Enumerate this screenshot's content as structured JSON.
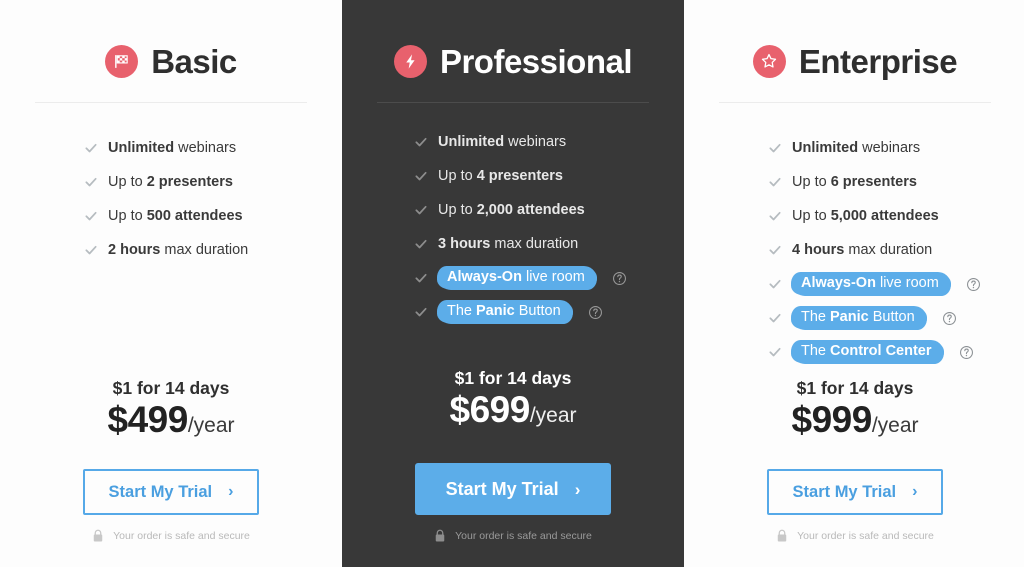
{
  "theme": {
    "page_background": "#ffffff",
    "card_background": "#fdfdfd",
    "featured_background": "#383838",
    "badge_color": "#e8616d",
    "accent_blue": "#5cade9",
    "highlight_blue": "#5cade9",
    "text_dark": "#2f2f2f",
    "text_light": "#ffffff",
    "check_gray": "#b6bcc0",
    "rule_gray": "#ececec"
  },
  "plans": [
    {
      "id": "basic",
      "name": "Basic",
      "icon": "checkered-flag-icon",
      "featured": false,
      "features": [
        {
          "prefix": "",
          "strong": "Unlimited",
          "suffix": " webinars",
          "highlight": false,
          "help": false
        },
        {
          "prefix": "Up to ",
          "strong": "2 presenters",
          "suffix": "",
          "highlight": false,
          "help": false
        },
        {
          "prefix": "Up to ",
          "strong": "500 attendees",
          "suffix": "",
          "highlight": false,
          "help": false
        },
        {
          "prefix": "",
          "strong": "2 hours",
          "suffix": " max duration",
          "highlight": false,
          "help": false
        }
      ],
      "trial": "$1 for 14 days",
      "price": "$499",
      "period": "/year",
      "cta_label": "Start My Trial",
      "cta_arrow": "›",
      "secure_note": "Your order is safe and secure"
    },
    {
      "id": "professional",
      "name": "Professional",
      "icon": "lightning-bolt-icon",
      "featured": true,
      "features": [
        {
          "prefix": "",
          "strong": "Unlimited",
          "suffix": " webinars",
          "highlight": false,
          "help": false
        },
        {
          "prefix": "Up to ",
          "strong": "4 presenters",
          "suffix": "",
          "highlight": false,
          "help": false
        },
        {
          "prefix": "Up to ",
          "strong": "2,000 attendees",
          "suffix": "",
          "highlight": false,
          "help": false
        },
        {
          "prefix": "",
          "strong": "3 hours",
          "suffix": " max duration",
          "highlight": false,
          "help": false
        },
        {
          "prefix": "",
          "strong": "Always-On",
          "suffix": " live room",
          "highlight": true,
          "help": true
        },
        {
          "prefix": "The ",
          "strong": "Panic",
          "suffix": " Button",
          "highlight": true,
          "help": true
        }
      ],
      "trial": "$1 for 14 days",
      "price": "$699",
      "period": "/year",
      "cta_label": "Start My Trial",
      "cta_arrow": "›",
      "secure_note": "Your order is safe and secure"
    },
    {
      "id": "enterprise",
      "name": "Enterprise",
      "icon": "star-icon",
      "featured": false,
      "features": [
        {
          "prefix": "",
          "strong": "Unlimited",
          "suffix": " webinars",
          "highlight": false,
          "help": false
        },
        {
          "prefix": "Up to ",
          "strong": "6 presenters",
          "suffix": "",
          "highlight": false,
          "help": false
        },
        {
          "prefix": "Up to ",
          "strong": "5,000 attendees",
          "suffix": "",
          "highlight": false,
          "help": false
        },
        {
          "prefix": "",
          "strong": "4 hours",
          "suffix": " max duration",
          "highlight": false,
          "help": false
        },
        {
          "prefix": "",
          "strong": "Always-On",
          "suffix": " live room",
          "highlight": true,
          "help": true
        },
        {
          "prefix": "The ",
          "strong": "Panic",
          "suffix": " Button",
          "highlight": true,
          "help": true
        },
        {
          "prefix": "The ",
          "strong": "Control Center",
          "suffix": "",
          "highlight": true,
          "help": true
        }
      ],
      "trial": "$1 for 14 days",
      "price": "$999",
      "period": "/year",
      "cta_label": "Start My Trial",
      "cta_arrow": "›",
      "secure_note": "Your order is safe and secure"
    }
  ]
}
